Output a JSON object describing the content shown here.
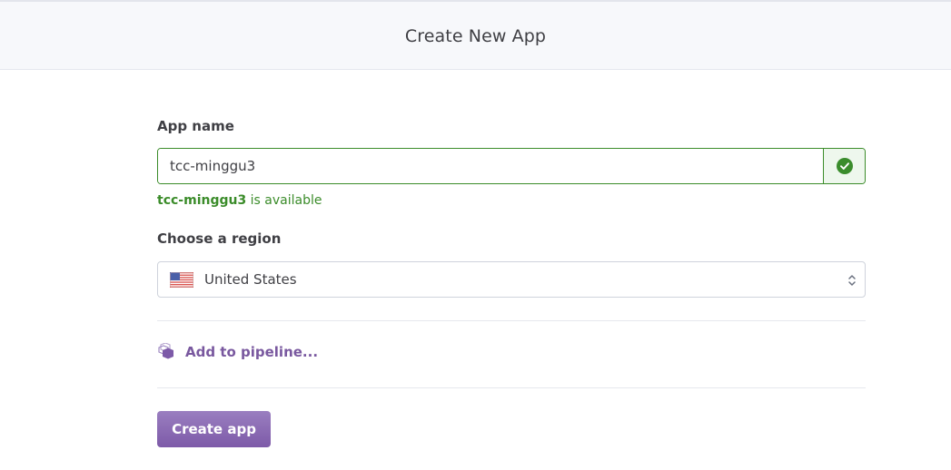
{
  "header": {
    "title": "Create New App"
  },
  "form": {
    "app_name_label": "App name",
    "app_name_value": "tcc-minggu3",
    "availability": {
      "name": "tcc-minggu3",
      "suffix": " is available"
    },
    "region_label": "Choose a region",
    "region": {
      "selected": "United States",
      "flag_icon": "us-flag-icon"
    },
    "pipeline_link": "Add to pipeline...",
    "submit_label": "Create app"
  },
  "colors": {
    "success_green": "#3b8c2a",
    "brand_purple": "#79589f",
    "button_purple": "#8a69b4",
    "header_bg": "#f7f8fb"
  }
}
